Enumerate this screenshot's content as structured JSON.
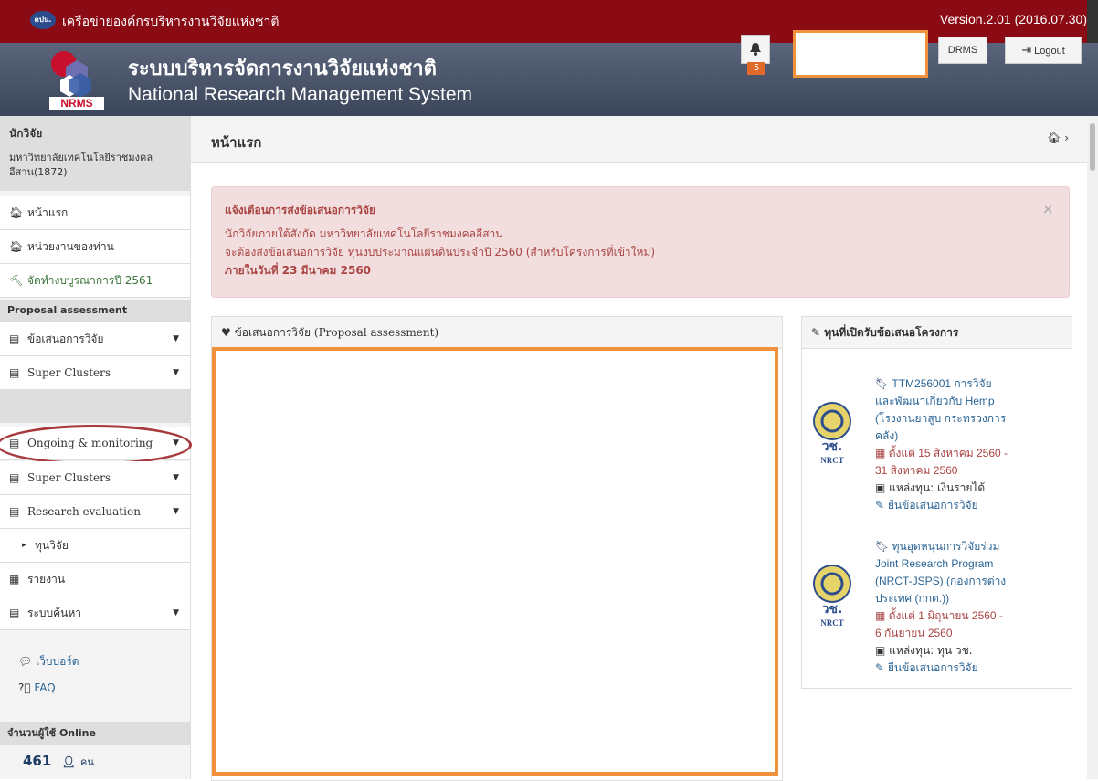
{
  "topbar": {
    "logo_text": "คปน.",
    "title": "เครือข่ายองค์กรบริหารงานวิจัยแห่งชาติ",
    "version": "Version.2.01 (2016.07.30)"
  },
  "header": {
    "logo_label": "NRMS",
    "brand_th": "ระบบบริหารจัดการงานวิจัยแห่งชาติ",
    "brand_en": "National Research Management System",
    "notification_count": "5",
    "drms_label": "DRMS",
    "logout_label": "Logout"
  },
  "user": {
    "role": "นักวิจัย",
    "organization": "มหาวิทยาลัยเทคโนโลยีราชมงคลอีสาน(1872)"
  },
  "sidebar": {
    "nav": [
      {
        "label": "หน้าแรก",
        "icon": "home-icon"
      },
      {
        "label": "หน่วยงานของท่าน",
        "icon": "home-icon"
      },
      {
        "label": "จัดทำงบบูรณาการปี 2561",
        "icon": "gavel-icon"
      }
    ],
    "section_proposal": "Proposal assessment",
    "proposal_items": [
      {
        "label": "ข้อเสนอการวิจัย"
      },
      {
        "label": "Super Clusters"
      }
    ],
    "monitoring_items": [
      {
        "label": "Ongoing & monitoring"
      },
      {
        "label": "Super Clusters"
      },
      {
        "label": "Research evaluation"
      }
    ],
    "fund_label": "ทุนวิจัย",
    "report_label": "รายงาน",
    "search_label": "ระบบค้นหา",
    "webboard_label": "เว็บบอร์ด",
    "faq_label": "FAQ",
    "online_head": "จำนวนผู้ใช้ Online",
    "online_count": "461",
    "online_unit": "คน"
  },
  "main": {
    "page_title": "หน้าแรก",
    "alert": {
      "title": "แจ้งเตือนการส่งข้อเสนอการวิจัย",
      "line1": "นักวิจัยภายใต้สังกัด มหาวิทยาลัยเทคโนโลยีราชมงคลอีสาน",
      "line2": "จะต้องส่งข้อเสนอการวิจัย ทุนงบประมาณแผ่นดินประจำปี 2560 (สำหรับโครงการที่เข้าใหม่)",
      "line3": "ภายในวันที่ 23 มีนาคม 2560",
      "close": "×"
    },
    "proposal_panel_title": "ข้อเสนอการวิจัย (Proposal assessment)",
    "funds_panel_title": "ทุนที่เปิดรับข้อเสนอโครงการ",
    "funds": [
      {
        "logo_text": "วช.",
        "logo_sub": "NRCT",
        "title": "TTM256001 การวิจัยและพัฒนาเกี่ยวกับ Hemp (โรงงานยาสูบ กระทรวงการคลัง)",
        "date": "ตั้งแต่ 15 สิงหาคม 2560 - 31 สิงหาคม 2560",
        "source": "แหล่งทุน: เงินรายได้",
        "submit": "ยื่นข้อเสนอการวิจัย"
      },
      {
        "logo_text": "วช.",
        "logo_sub": "NRCT",
        "title": "ทุนอุดหนุนการวิจัยร่วม Joint Research Program (NRCT-JSPS) (กองการต่างประเทศ (กกต.))",
        "date": "ตั้งแต่ 1 มิถุนายน 2560 - 6 กันยายน 2560",
        "source": "แหล่งทุน: ทุน วช.",
        "submit": "ยื่นข้อเสนอการวิจัย"
      }
    ]
  },
  "colors": {
    "topbar": "#8b0b15",
    "header": "#4b556a",
    "highlight": "#f0913d",
    "alert_text": "#a94442",
    "link": "#2a6496"
  }
}
